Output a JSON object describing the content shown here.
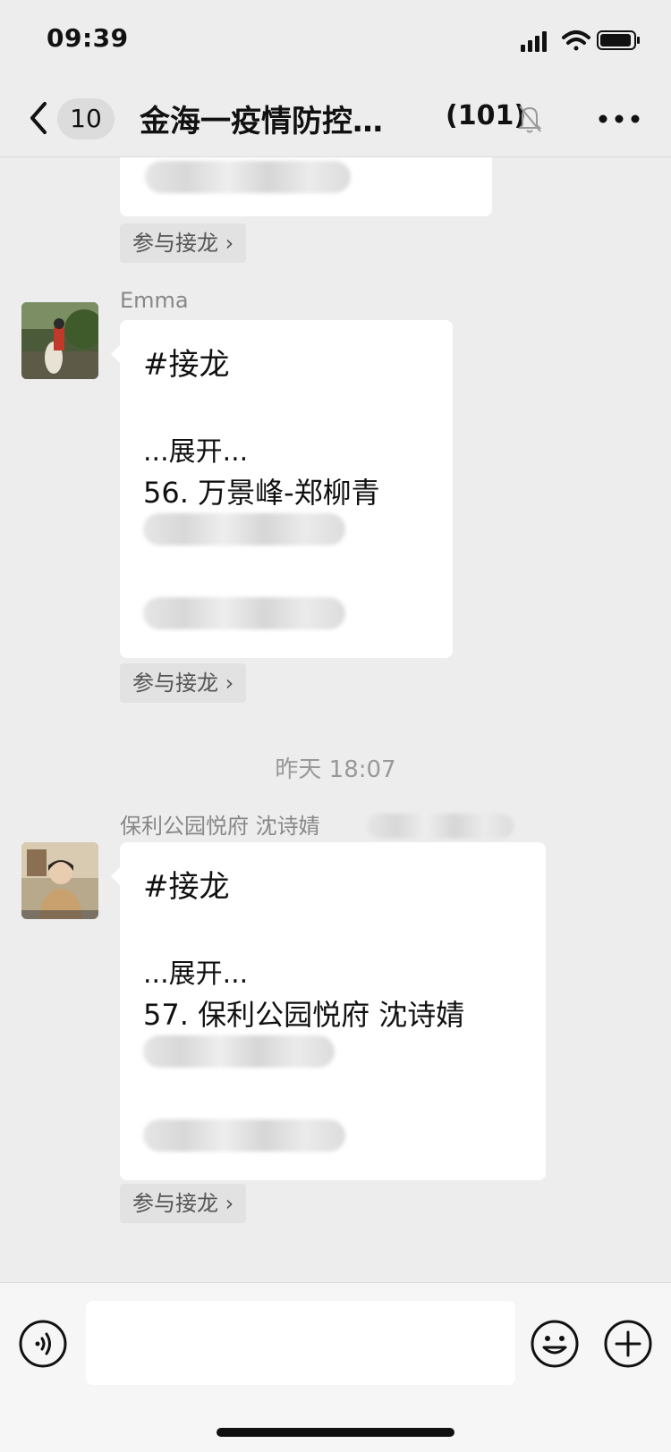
{
  "status_bar": {
    "time": "09:39",
    "icons": [
      "signal-icon",
      "wifi-icon",
      "battery-icon"
    ]
  },
  "nav": {
    "unread_count": "10",
    "title": "金海一疫情防控…",
    "member_count": "(101)",
    "icons": [
      "back-icon",
      "mute-bell-icon",
      "more-icon"
    ]
  },
  "messages": [
    {
      "kind": "partial-bubble",
      "join_label": "参与接龙 ›"
    },
    {
      "kind": "solitaire",
      "sender": "Emma",
      "tag": "#接龙",
      "expand": "...展开...",
      "entry": "56. 万景峰-郑柳青",
      "join_label": "参与接龙 ›"
    },
    {
      "kind": "timestamp",
      "text": "昨天 18:07"
    },
    {
      "kind": "solitaire",
      "sender": "保利公园悦府 沈诗婧",
      "tag": "#接龙",
      "expand": "...展开...",
      "entry": "57. 保利公园悦府 沈诗婧",
      "join_label": "参与接龙 ›"
    }
  ],
  "input_bar": {
    "placeholder": "",
    "icons": [
      "voice-icon",
      "emoji-icon",
      "plus-icon"
    ]
  },
  "colors": {
    "background": "#ededed",
    "bubble": "#ffffff",
    "chip": "#e2e2e2",
    "meta_text": "#888888"
  }
}
